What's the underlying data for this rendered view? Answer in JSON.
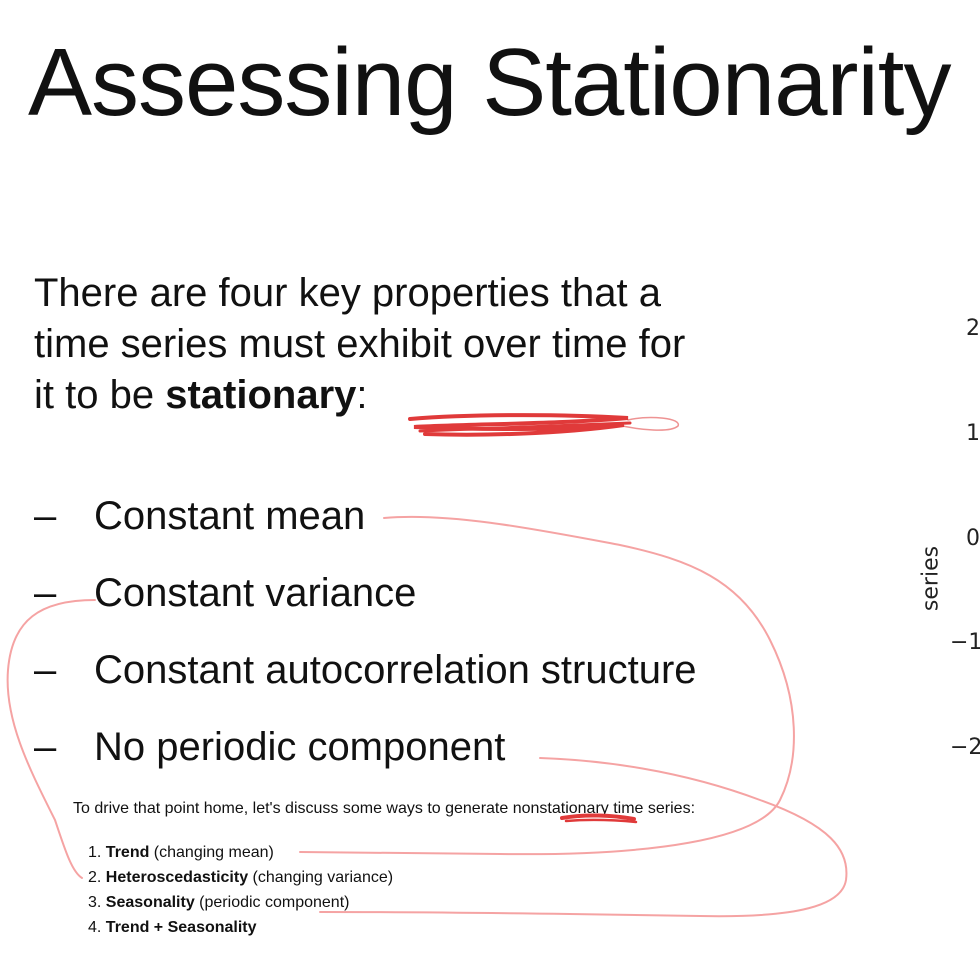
{
  "slide": {
    "title": "Assessing Stationarity",
    "intro_before": "There are four key properties that a time series must exhibit over time for it to be ",
    "intro_bold": "stationary",
    "intro_after": ":",
    "dash": "–",
    "properties": [
      "Constant mean",
      "Constant variance",
      "Constant autocorrelation structure",
      "No periodic component"
    ]
  },
  "notes": {
    "paragraph": "To drive that point home, let's discuss some ways to generate nonstationary time series:",
    "items": [
      {
        "num": "1.",
        "bold": "Trend",
        "rest": " (changing mean)"
      },
      {
        "num": "2.",
        "bold": "Heteroscedasticity",
        "rest": " (changing variance)"
      },
      {
        "num": "3.",
        "bold": "Seasonality",
        "rest": " (periodic component)"
      },
      {
        "num": "4.",
        "bold": "Trend + Seasonality",
        "rest": ""
      }
    ]
  },
  "plot_fragment": {
    "ylabel": "series",
    "ticks": [
      "2",
      "1",
      "0",
      "−1",
      "−2"
    ]
  },
  "colors": {
    "annotation": "#e03a3a"
  }
}
